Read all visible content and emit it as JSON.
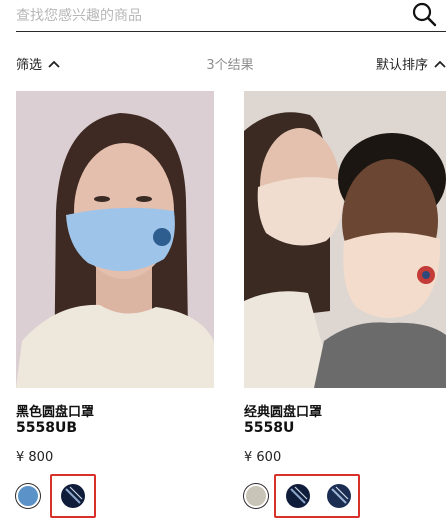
{
  "search": {
    "placeholder": "查找您感兴趣的商品",
    "value": ""
  },
  "toolbar": {
    "filter_label": "筛选",
    "result_count": "3个结果",
    "sort_label": "默认排序"
  },
  "products": [
    {
      "name": "黑色圆盘口罩",
      "code": "5558UB",
      "price": "¥ 800",
      "swatches": [
        {
          "color": "#5b92c8",
          "pattern": "solid"
        },
        {
          "color": "#0f1d3a",
          "pattern": "stripe"
        }
      ]
    },
    {
      "name": "经典圆盘口罩",
      "code": "5558U",
      "price": "¥ 600",
      "swatches": [
        {
          "color": "#c9c4b8",
          "pattern": "solid"
        },
        {
          "color": "#0f1d3a",
          "pattern": "stripe"
        },
        {
          "color": "#1b2e52",
          "pattern": "stripe"
        }
      ]
    }
  ],
  "colors": {
    "highlight": "#d8312a",
    "placeholder": "#b7b7b7",
    "count": "#8d8d8d"
  }
}
